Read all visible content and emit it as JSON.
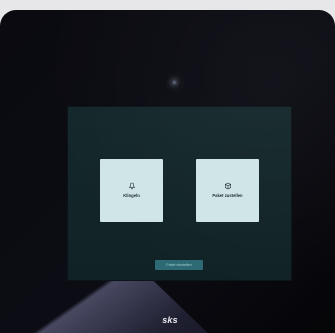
{
  "device": {
    "brand": "sks"
  },
  "screen": {
    "tiles": [
      {
        "label": "Klingeln",
        "icon": "bell-icon"
      },
      {
        "label": "Paket zustellen",
        "icon": "package-icon"
      }
    ],
    "bottom_button_label": "Paket einstellen"
  },
  "colors": {
    "screen_bg": "#132529",
    "tile_bg": "#cfe5e7",
    "button_bg": "#2d6a73"
  }
}
